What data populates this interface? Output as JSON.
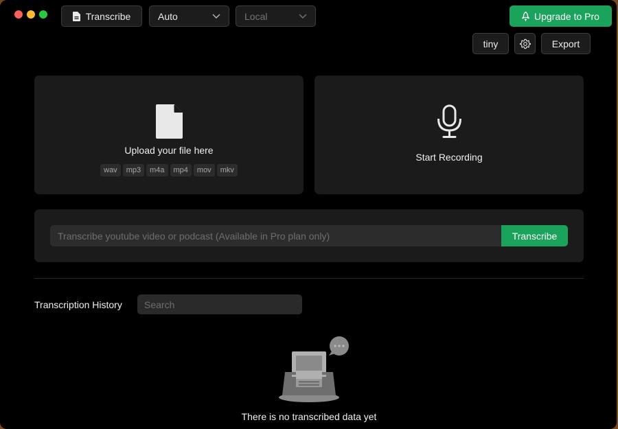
{
  "toolbar": {
    "transcribe_label": "Transcribe",
    "language_select": "Auto",
    "engine_select": "Local",
    "upgrade_label": "Upgrade to Pro",
    "model_label": "tiny",
    "export_label": "Export"
  },
  "upload_card": {
    "title": "Upload your file here",
    "formats": [
      "wav",
      "mp3",
      "m4a",
      "mp4",
      "mov",
      "mkv"
    ]
  },
  "record_card": {
    "title": "Start Recording"
  },
  "youtube": {
    "placeholder": "Transcribe youtube video or podcast (Available in Pro plan only)",
    "button_label": "Transcribe"
  },
  "history": {
    "title": "Transcription History",
    "search_placeholder": "Search",
    "empty_text": "There is no transcribed data yet"
  },
  "icons": {
    "file": "file-icon",
    "mic": "microphone-icon",
    "gear": "gear-icon",
    "rocket": "rocket-icon",
    "chevron": "chevron-down-icon"
  },
  "colors": {
    "accent": "#1aa35a",
    "background": "#000000",
    "card": "#1b1b1b"
  }
}
